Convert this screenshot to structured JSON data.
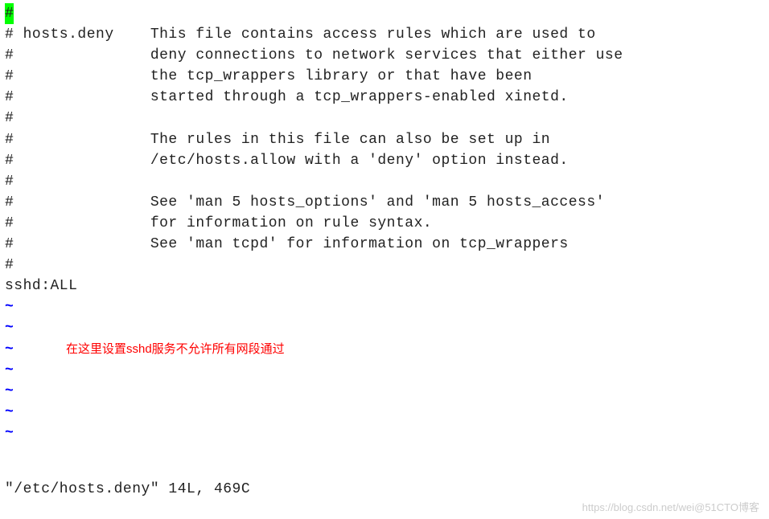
{
  "file": {
    "lines": [
      "#",
      "# hosts.deny    This file contains access rules which are used to",
      "#               deny connections to network services that either use",
      "#               the tcp_wrappers library or that have been",
      "#               started through a tcp_wrappers-enabled xinetd.",
      "#",
      "#               The rules in this file can also be set up in",
      "#               /etc/hosts.allow with a 'deny' option instead.",
      "#",
      "#               See 'man 5 hosts_options' and 'man 5 hosts_access'",
      "#               for information on rule syntax.",
      "#               See 'man tcpd' for information on tcp_wrappers",
      "#",
      "sshd:ALL"
    ],
    "cursor_line_char": "#"
  },
  "tildes": [
    "~",
    "~",
    "~",
    "~",
    "~",
    "~",
    "~"
  ],
  "annotation": "在这里设置sshd服务不允许所有网段通过",
  "status": "\"/etc/hosts.deny\" 14L, 469C",
  "watermark": "https://blog.csdn.net/wei@51CTO博客"
}
